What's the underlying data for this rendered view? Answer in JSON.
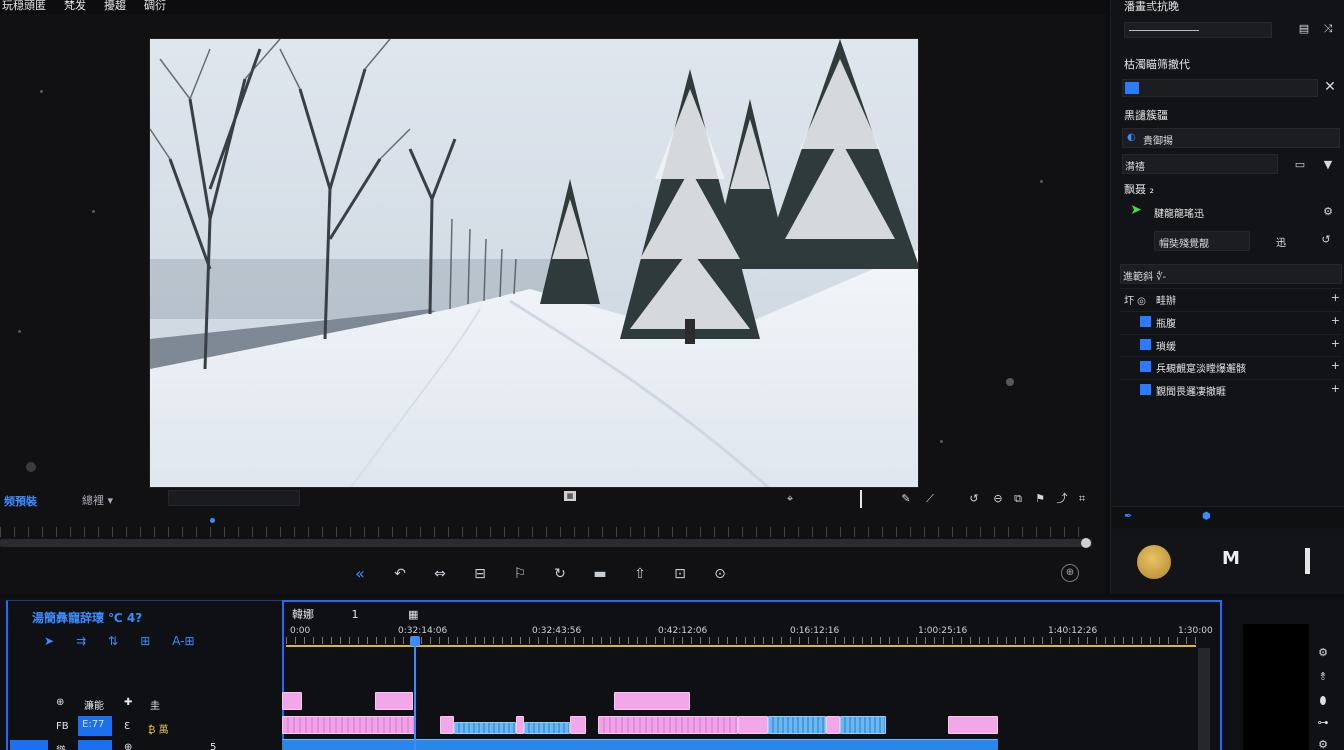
{
  "top_menu": [
    "玩穏頭匿",
    "梵发",
    "擾趨",
    "碉衍"
  ],
  "preview": {
    "label": "频預裝",
    "dropdown": "總裡 ▾",
    "frame_marker": "▦"
  },
  "transport": {
    "icons": [
      "back-icon",
      "rewind-icon",
      "step-icon",
      "mark-in-icon",
      "flag-icon",
      "loop-icon",
      "comment-icon",
      "export-icon",
      "clip-icon",
      "settings-icon"
    ]
  },
  "right_panel": {
    "header": "潘畫弎抗晚",
    "section1_title": "枯濁瞄筛撤代",
    "section2_title": "黑譴簇疆",
    "section2_value": "貴御揚",
    "field_label": "潸禧",
    "section3_title": "飘聂 ₂",
    "action_label": "腱龍龍瑤迅",
    "button_label": "帽奘殘覺靓",
    "button_side": "迅",
    "list_title": "進範斜 ∜-",
    "list_items": [
      {
        "label": "畦辦",
        "checked": false,
        "header": "圷 ◎"
      },
      {
        "label": "瓶腹",
        "checked": true
      },
      {
        "label": "瑣缓",
        "checked": true
      },
      {
        "label": "兵覡覿寔淡瞠爆邂骸",
        "checked": true
      },
      {
        "label": "覲聞畏邏凄撤睚",
        "checked": true
      }
    ]
  },
  "timeline": {
    "title": "湯簡彝寵辞瓌 ℃ 4?",
    "sequence_tab": "韓娜",
    "sequence_num": "1",
    "ruler_labels": [
      "0:00",
      "0:32:14:06",
      "0:32:43:56",
      "0:42:12:06",
      "0:16:12:16",
      "1:00:25:16",
      "1:40:12:26",
      "1:30:00"
    ],
    "tracks": [
      {
        "name": "濂能",
        "icon": "⊕",
        "extra": "圭"
      },
      {
        "name": "E:77",
        "icon": "FB",
        "extra": "₿ 萬"
      },
      {
        "name": "聳",
        "icon": "⊕",
        "extra": "5"
      }
    ]
  },
  "colors": {
    "accent": "#2a7bff",
    "clip_pink": "#f2a7e9",
    "clip_blue": "#5aa8ea",
    "ruler_line": "#d8b43a"
  }
}
